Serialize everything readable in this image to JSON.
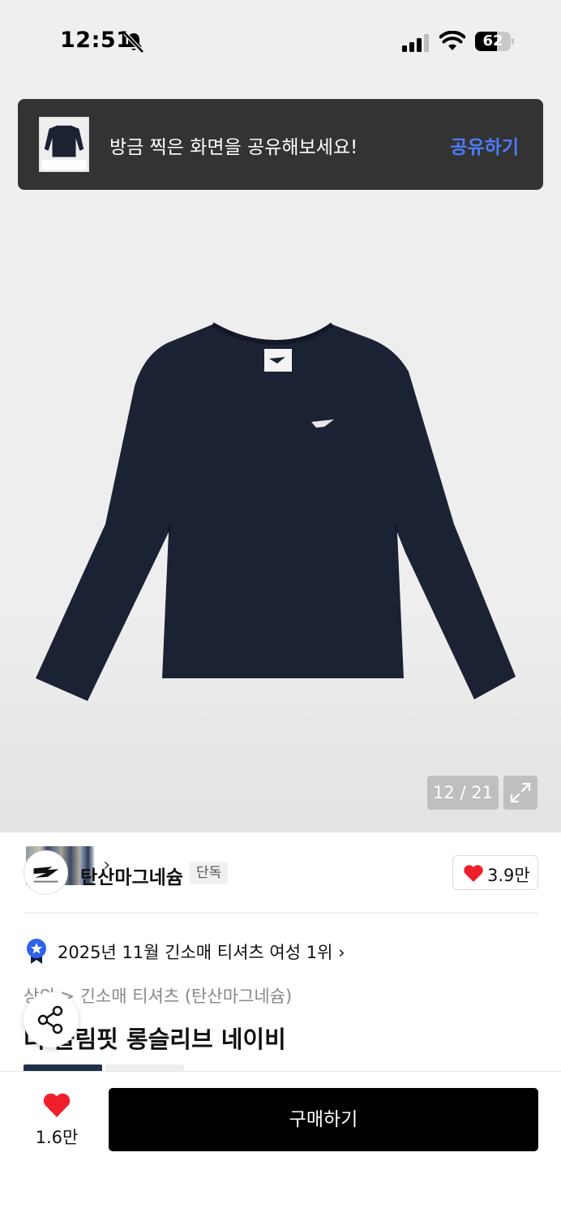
{
  "status_bar": {
    "time": "12:51",
    "battery_percent": 62,
    "icons": [
      "bell-slash-icon",
      "cellular-signal-icon",
      "wifi-icon",
      "battery-icon"
    ]
  },
  "share_toast": {
    "message": "방금 찍은 화면을 공유해보세요!",
    "action": "공유하기"
  },
  "gallery": {
    "counter": "12 / 21",
    "fullscreen_icon": "expand-icon",
    "thumb_chevron": "›"
  },
  "brand": {
    "name": "탄산마그네슘",
    "badge": "단독",
    "likes": "3.9만"
  },
  "ranking": {
    "text": "2025년 11월 긴소매 티셔츠 여성 1위",
    "chevron": "›"
  },
  "breadcrumb": "상의 > 긴소매 티셔츠 (탄산마그네슘)",
  "product_title": "더 슬림핏 롱슬리브 네이비",
  "bottom_bar": {
    "wish_count": "1.6만",
    "buy_label": "구매하기"
  },
  "colors": {
    "accent_blue": "#4b7cf5",
    "heart_red": "#ef1f2b",
    "toast_bg": "#333333",
    "shirt_navy": "#1b2233"
  }
}
